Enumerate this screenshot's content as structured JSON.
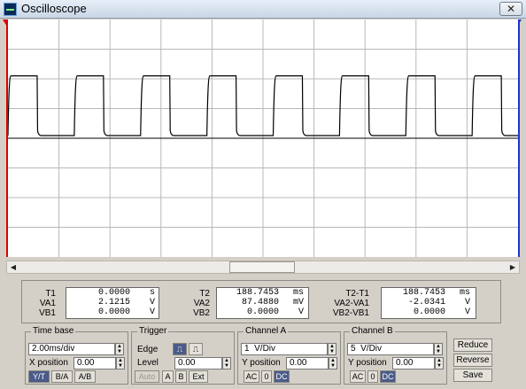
{
  "window": {
    "title": "Oscilloscope",
    "close_label": "✕"
  },
  "chart_data": {
    "type": "line",
    "xlim": [
      0,
      20
    ],
    "ylim": [
      -4,
      4
    ],
    "x_unit": "ms",
    "y_unit": "V",
    "grid": true,
    "series": [
      {
        "color": "#000000",
        "shape": "square-wave",
        "high_level": 2.1,
        "low_level": 0.09,
        "period": 2.6,
        "duty_cycle": 0.44,
        "first_rise": 0.0
      }
    ]
  },
  "readout": {
    "t1": {
      "label": "T1",
      "value": "0.0000",
      "unit": "s"
    },
    "va1": {
      "label": "VA1",
      "value": "2.1215",
      "unit": "V"
    },
    "vb1": {
      "label": "VB1",
      "value": "0.0000",
      "unit": "V"
    },
    "t2": {
      "label": "T2",
      "value": "188.7453",
      "unit": "ms"
    },
    "va2": {
      "label": "VA2",
      "value": "87.4880",
      "unit": "mV"
    },
    "vb2": {
      "label": "VB2",
      "value": "0.0000",
      "unit": "V"
    },
    "dt": {
      "label": "T2-T1",
      "value": "188.7453",
      "unit": "ms"
    },
    "dva": {
      "label": "VA2-VA1",
      "value": "-2.0341",
      "unit": "V"
    },
    "dvb": {
      "label": "VB2-VB1",
      "value": "0.0000",
      "unit": "V"
    }
  },
  "timebase": {
    "title": "Time base",
    "scale": "2.00ms/div",
    "xpos_label": "X position",
    "xpos": "0.00",
    "mode_yt": "Y/T",
    "mode_ba": "B/A",
    "mode_ab": "A/B"
  },
  "trigger": {
    "title": "Trigger",
    "edge_label": "Edge",
    "level_label": "Level",
    "level": "0.00",
    "auto": "Auto",
    "a": "A",
    "b": "B",
    "ext": "Ext"
  },
  "channel_a": {
    "title": "Channel A",
    "scale": "1  V/Div",
    "ypos_label": "Y position",
    "ypos": "0.00",
    "ac": "AC",
    "zero": "0",
    "dc": "DC"
  },
  "channel_b": {
    "title": "Channel B",
    "scale": "5  V/Div",
    "ypos_label": "Y position",
    "ypos": "0.00",
    "ac": "AC",
    "zero": "0",
    "dc": "DC"
  },
  "actions": {
    "reduce": "Reduce",
    "reverse": "Reverse",
    "save": "Save"
  }
}
